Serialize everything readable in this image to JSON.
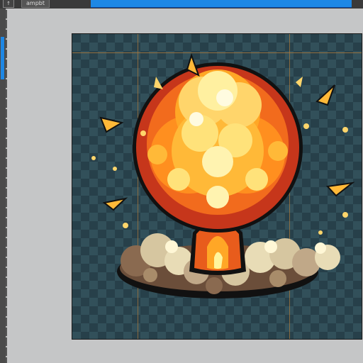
{
  "toolbar": {
    "tool_icon_glyph": "↑",
    "tab_label": "ampbt"
  },
  "canvas": {
    "sprite_name": "explosion-sprite"
  },
  "colors": {
    "accent": "#1e88e5",
    "canvas_bg": "#27404a",
    "guide": "#b07a3a"
  }
}
